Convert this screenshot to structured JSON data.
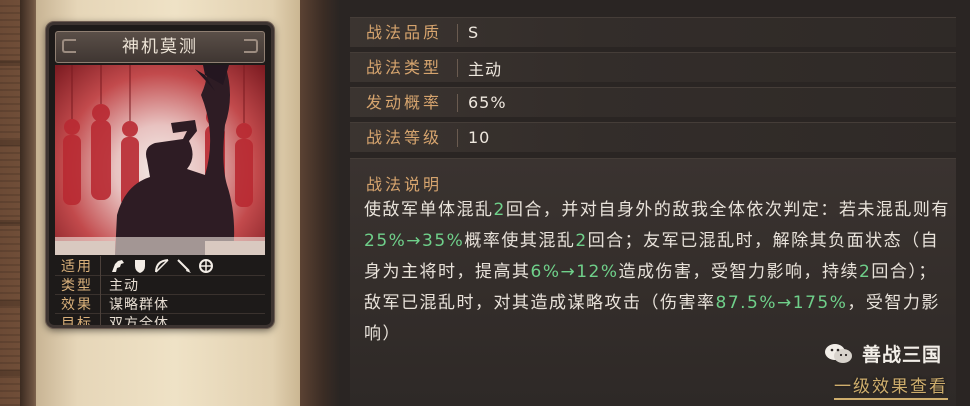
{
  "card": {
    "title": "神机莫测",
    "attributes": [
      {
        "key": "适用",
        "icons": [
          "cavalry-icon",
          "shield-icon",
          "bow-icon",
          "spear-icon",
          "siege-icon"
        ]
      },
      {
        "key": "类型",
        "value": "主动"
      },
      {
        "key": "效果",
        "value": "谋略群体"
      },
      {
        "key": "目标",
        "value": "双方全体"
      }
    ]
  },
  "properties": [
    {
      "key": "战法品质",
      "value": "S"
    },
    {
      "key": "战法类型",
      "value": "主动"
    },
    {
      "key": "发动概率",
      "value": "65%"
    },
    {
      "key": "战法等级",
      "value": "10"
    }
  ],
  "description": {
    "title": "战法说明",
    "segments": [
      {
        "t": "使敌军单体混乱",
        "c": "n"
      },
      {
        "t": "2",
        "c": "g"
      },
      {
        "t": "回合，并对自身外的敌我全体依次判定：若未混乱则有",
        "c": "n"
      },
      {
        "t": "25%→35%",
        "c": "g"
      },
      {
        "t": "概率使其混乱",
        "c": "n"
      },
      {
        "t": "2",
        "c": "g"
      },
      {
        "t": "回合；友军已混乱时，解除其负面状态（自身为主将时，提高其",
        "c": "n"
      },
      {
        "t": "6%→12%",
        "c": "g"
      },
      {
        "t": "造成伤害，受智力影响，持续",
        "c": "n"
      },
      {
        "t": "2",
        "c": "g"
      },
      {
        "t": "回合）；敌军已混乱时，对其造成谋略攻击（伤害率",
        "c": "n"
      },
      {
        "t": "87.5%→175%",
        "c": "g"
      },
      {
        "t": "，受智力影响）",
        "c": "n"
      }
    ]
  },
  "watermark": "善战三国",
  "more_link": "一级效果查看",
  "colors": {
    "highlight": "#6fd08a",
    "label": "#d6a46e",
    "art_red": "#c24a4c"
  }
}
